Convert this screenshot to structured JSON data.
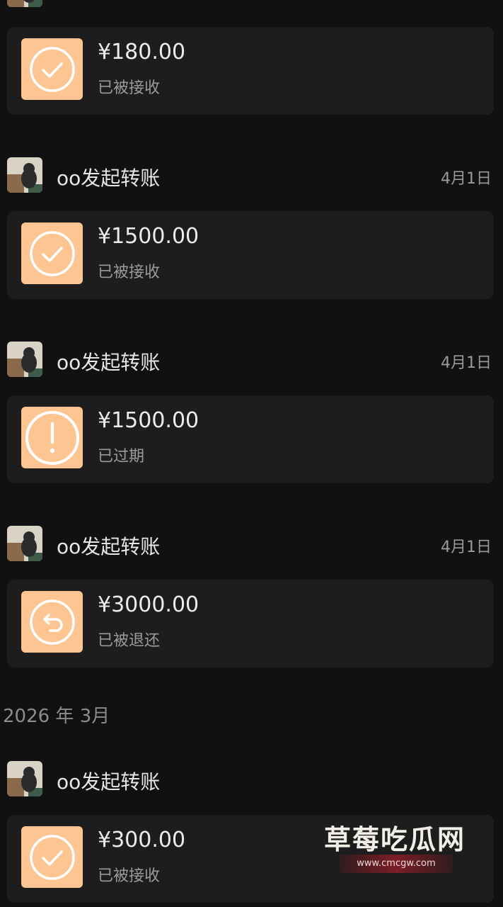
{
  "transfers": [
    {
      "title": "",
      "date": "",
      "amount": "¥180.00",
      "status": "已被接收",
      "icon": "check-circle-icon"
    },
    {
      "title": "oo发起转账",
      "date": "4月1日",
      "amount": "¥1500.00",
      "status": "已被接收",
      "icon": "check-circle-icon"
    },
    {
      "title": "oo发起转账",
      "date": "4月1日",
      "amount": "¥1500.00",
      "status": "已过期",
      "icon": "exclamation-circle-icon"
    },
    {
      "title": "oo发起转账",
      "date": "4月1日",
      "amount": "¥3000.00",
      "status": "已被退还",
      "icon": "return-arrow-circle-icon"
    },
    {
      "title": "oo发起转账",
      "date": "",
      "amount": "¥300.00",
      "status": "已被接收",
      "icon": "check-circle-icon"
    }
  ],
  "month_label": "2026 年 3月",
  "watermark": {
    "title": "草莓吃瓜网",
    "url": "www.cmcgw.com"
  },
  "colors": {
    "background": "#111111",
    "card": "#1d1d1d",
    "icon_tile": "#fcc592"
  }
}
